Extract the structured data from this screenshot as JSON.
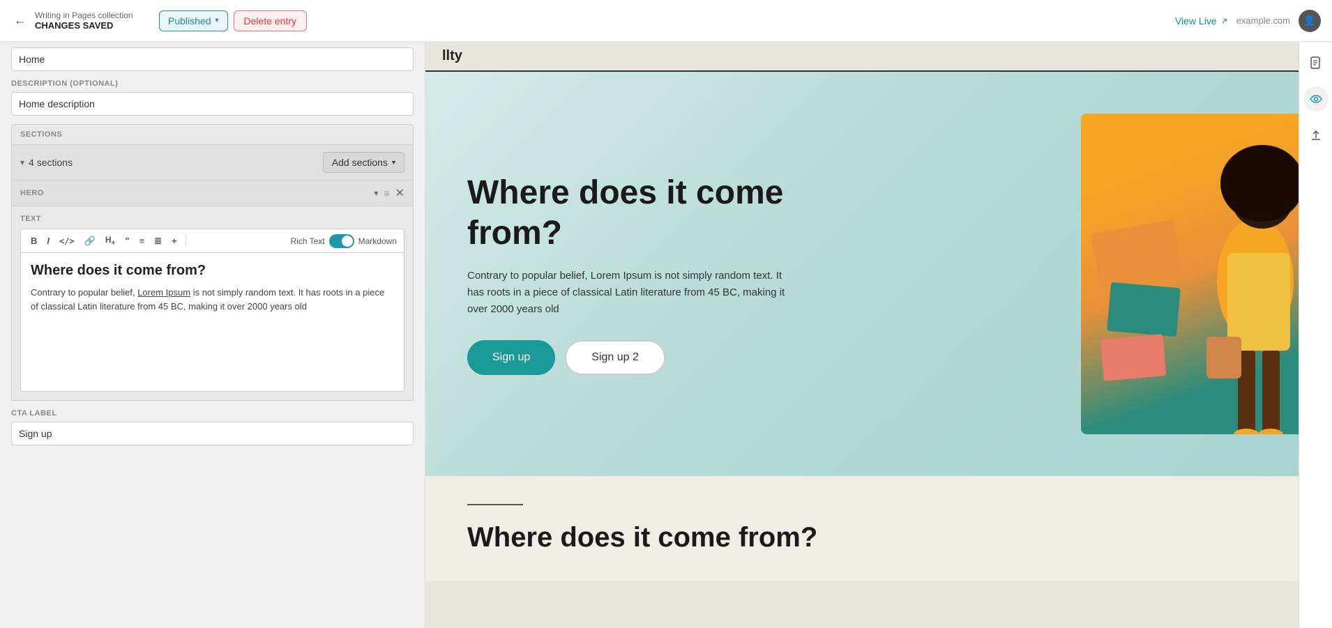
{
  "header": {
    "back_icon": "←",
    "breadcrumb": "Writing in Pages collection",
    "subtitle": "CHANGES SAVED",
    "published_label": "Published",
    "delete_label": "Delete entry",
    "view_live_label": "View Live",
    "domain": "example.com"
  },
  "left_panel": {
    "home_value": "Home",
    "description_label": "DESCRIPTION (OPTIONAL)",
    "description_value": "Home description",
    "sections_label": "SECTIONS",
    "sections_count": "4 sections",
    "add_sections_label": "Add sections",
    "hero_label": "HERO",
    "text_label": "TEXT",
    "rich_text_label": "Rich Text",
    "markdown_label": "Markdown",
    "editor_heading": "Where does it come from?",
    "editor_body": "Contrary to popular belief, Lorem Ipsum is not simply random text. It has roots in a piece of classical Latin literature from 45 BC, making it over 2000 years old",
    "cta_label": "CTA LABEL",
    "cta_value": "Sign up"
  },
  "toolbar": {
    "bold": "B",
    "italic": "I",
    "code": "</>",
    "link": "🔗",
    "heading": "H+",
    "quote": "\"",
    "bullet": "≡",
    "ordered": "≣",
    "plus": "+"
  },
  "preview": {
    "logo": "llty",
    "hero_title": "Where does it come from?",
    "hero_desc": "Contrary to popular belief, Lorem Ipsum is not simply random text. It has roots in a piece of classical Latin literature from 45 BC, making it over 2000 years old",
    "btn1_label": "Sign up",
    "btn2_label": "Sign up 2",
    "second_title": "Where does it come from?"
  },
  "colors": {
    "teal": "#1a9a96",
    "teal_light": "#e8f4f4",
    "delete_red": "#e53935",
    "delete_bg": "#fff0f0"
  }
}
